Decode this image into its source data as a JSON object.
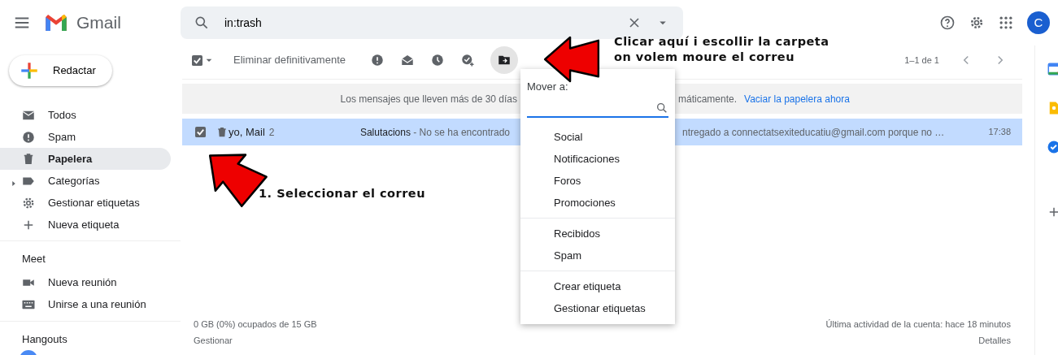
{
  "header": {
    "app_name": "Gmail",
    "search": {
      "value": "in:trash"
    },
    "avatar_letter": "C"
  },
  "compose": "Redactar",
  "sidebar": {
    "items": [
      {
        "label": "Todos",
        "selected": false
      },
      {
        "label": "Spam",
        "selected": false
      },
      {
        "label": "Papelera",
        "selected": true
      },
      {
        "label": "Categorías",
        "selected": false
      },
      {
        "label": "Gestionar etiquetas",
        "selected": false
      },
      {
        "label": "Nueva etiqueta",
        "selected": false
      }
    ],
    "meet": {
      "title": "Meet",
      "items": [
        {
          "label": "Nueva reunión"
        },
        {
          "label": "Unirse a una reunión"
        }
      ]
    },
    "hangouts": {
      "title": "Hangouts"
    }
  },
  "toolbar": {
    "select_all_checked": true,
    "delete_forever": "Eliminar definitivamente",
    "pagination": "1–1 de 1"
  },
  "banner": {
    "text_start": "Los mensajes que lleven más de 30 días",
    "text_end": "máticamente.",
    "link": "Vaciar la papelera ahora"
  },
  "messages": [
    {
      "checked": true,
      "sender": "yo, Mail",
      "count": "2",
      "subject": "Salutacions",
      "snippet_start": " - No se ha encontrado",
      "snippet_end": "ntregado a connectatsexiteducatiu@gmail.com porque no …",
      "time": "17:38"
    }
  ],
  "footer": {
    "storage": "0 GB (0%) ocupados de 15 GB",
    "manage": "Gestionar",
    "activity": "Última actividad de la cuenta: hace 18 minutos",
    "details": "Detalles"
  },
  "move_menu": {
    "title": "Mover a:",
    "groups": [
      [
        "Social",
        "Notificaciones",
        "Foros",
        "Promociones"
      ],
      [
        "Recibidos",
        "Spam"
      ],
      [
        "Crear etiqueta",
        "Gestionar etiquetas"
      ]
    ]
  },
  "annotations": [
    {
      "kind": "move",
      "lines": [
        "Clicar aquí i escollir la carpeta",
        "on volem moure el correu"
      ]
    },
    {
      "kind": "select",
      "lines": [
        "1. Seleccionar el correu"
      ]
    }
  ]
}
